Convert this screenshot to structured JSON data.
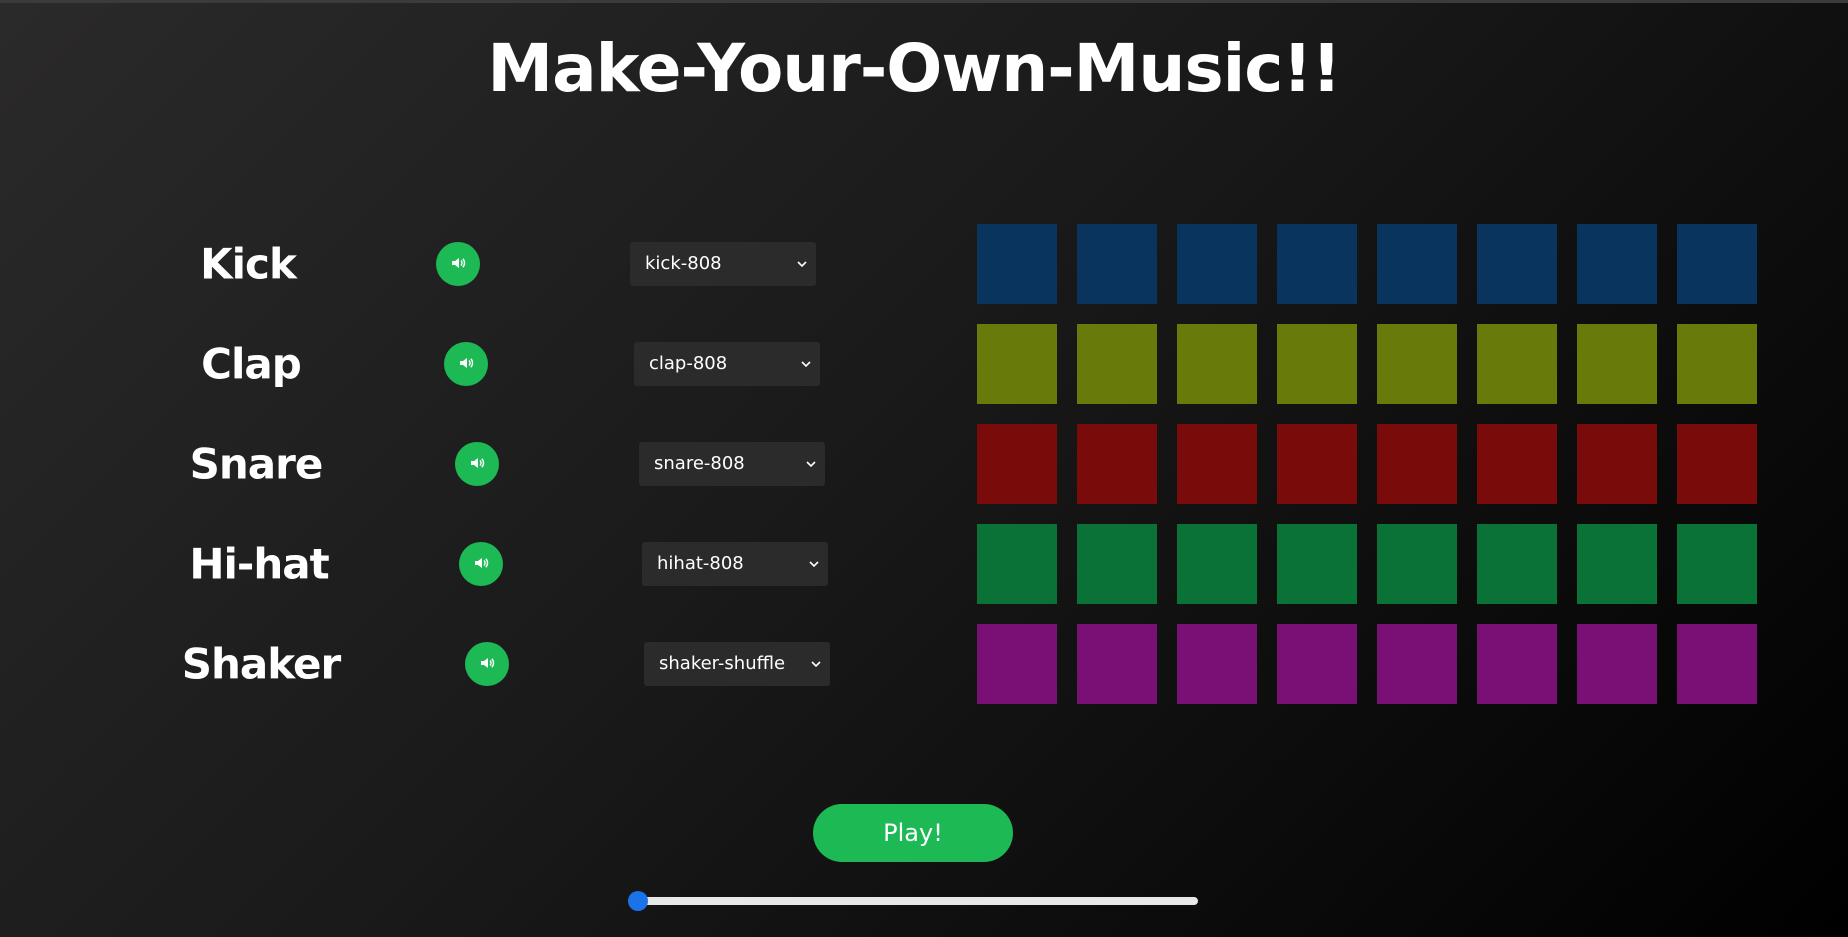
{
  "page": {
    "title": "Make-Your-Own-Music!!"
  },
  "colors": {
    "accent": "#1db954",
    "select_bg": "#2b2b2b",
    "slider_thumb": "#1a73e8"
  },
  "tracks": [
    {
      "name": "Kick",
      "sound": "kick-808",
      "mute_icon": "speaker-icon",
      "pad_color": "#09345e",
      "pads": 8
    },
    {
      "name": "Clap",
      "sound": "clap-808",
      "mute_icon": "speaker-icon",
      "pad_color": "#677a0a",
      "pads": 8
    },
    {
      "name": "Snare",
      "sound": "snare-808",
      "mute_icon": "speaker-icon",
      "pad_color": "#7a0b0b",
      "pads": 8
    },
    {
      "name": "Hi-hat",
      "sound": "hihat-808",
      "mute_icon": "speaker-icon",
      "pad_color": "#0b7237",
      "pads": 8
    },
    {
      "name": "Shaker",
      "sound": "shaker-shuffle",
      "mute_icon": "speaker-icon",
      "pad_color": "#7a0f76",
      "pads": 8
    }
  ],
  "controls": {
    "play_label": "Play!",
    "tempo_slider_value": 0
  }
}
